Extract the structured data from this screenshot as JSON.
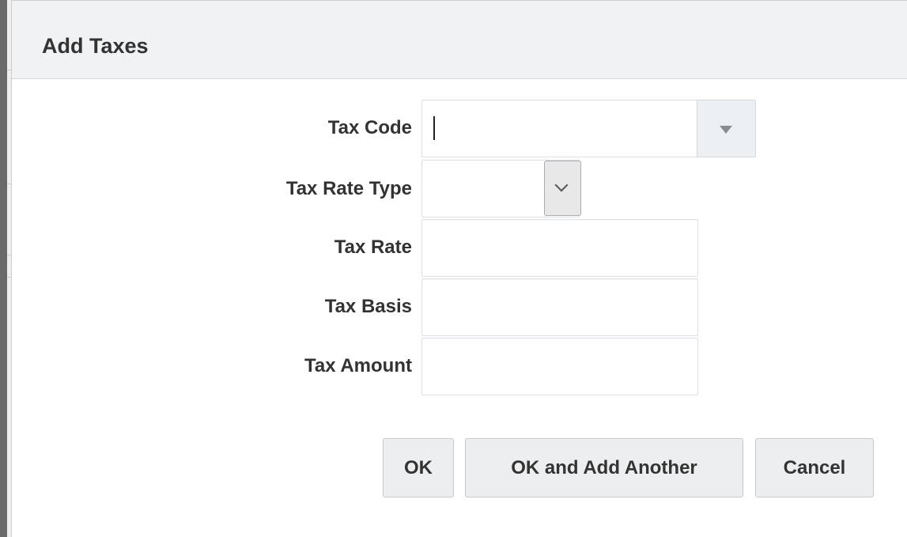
{
  "dialog": {
    "title": "Add Taxes"
  },
  "fields": {
    "tax_code": {
      "label": "Tax Code",
      "value": ""
    },
    "tax_rate_type": {
      "label": "Tax Rate Type",
      "value": ""
    },
    "tax_rate": {
      "label": "Tax Rate",
      "value": ""
    },
    "tax_basis": {
      "label": "Tax Basis",
      "value": ""
    },
    "tax_amount": {
      "label": "Tax Amount",
      "value": ""
    }
  },
  "buttons": {
    "ok": "OK",
    "ok_add_another": "OK and Add Another",
    "cancel": "Cancel"
  },
  "icons": {
    "tax_code_dropdown": "triangle-down-icon",
    "tax_rate_type_dropdown": "chevron-down-icon"
  },
  "colors": {
    "header_background": "#f0f2f4",
    "button_background": "#eceef0",
    "text": "#333333"
  }
}
